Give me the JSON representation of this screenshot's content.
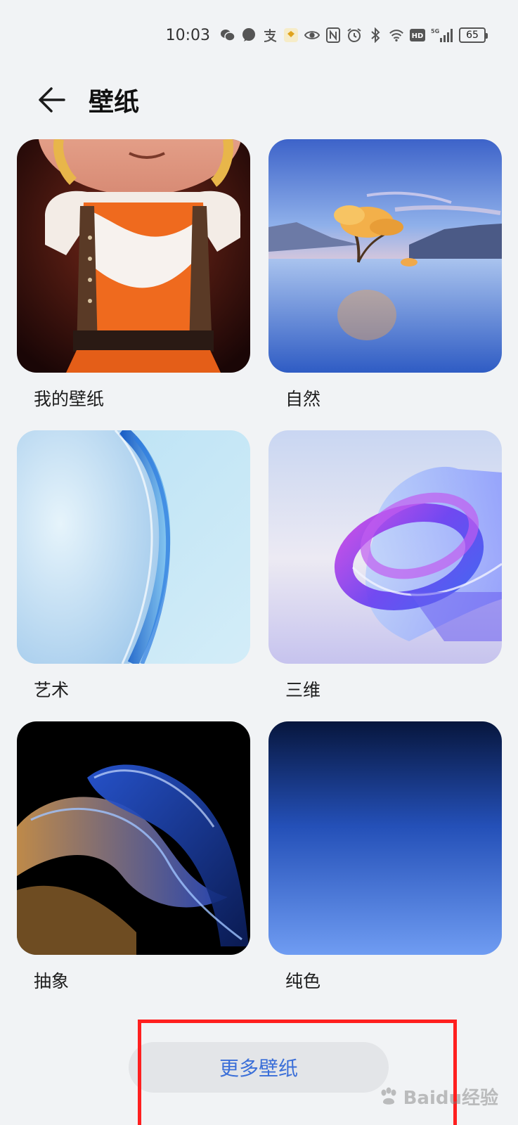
{
  "status_bar": {
    "time": "10:03",
    "battery": "65",
    "icons": [
      "wechat-icon",
      "chat-bubble-icon",
      "alipay-icon",
      "app-badge-icon",
      "eye-icon",
      "nfc-icon",
      "alarm-icon",
      "bluetooth-icon",
      "wifi-icon",
      "hd-icon",
      "signal-5g-icon",
      "battery-icon"
    ]
  },
  "header": {
    "title": "壁纸"
  },
  "categories": [
    {
      "label": "我的壁纸"
    },
    {
      "label": "自然"
    },
    {
      "label": "艺术"
    },
    {
      "label": "三维"
    },
    {
      "label": "抽象"
    },
    {
      "label": "纯色"
    }
  ],
  "more_button": {
    "label": "更多壁纸"
  },
  "watermark": {
    "text": "Baidu经验"
  },
  "colors": {
    "accent": "#3b6fd8",
    "highlight": "#ff1f1f",
    "background": "#f1f3f5"
  }
}
